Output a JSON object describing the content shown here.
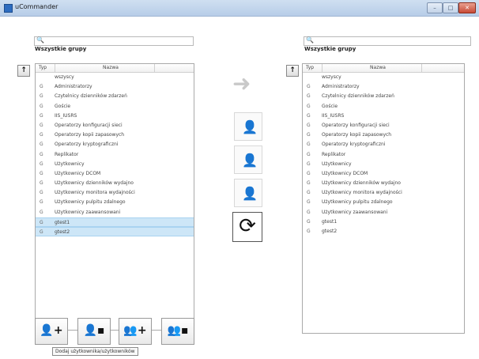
{
  "window": {
    "title": "uCommander",
    "controls": {
      "minimize": "–",
      "maximize": "□",
      "close": "✕"
    }
  },
  "left_panel": {
    "search_placeholder": "",
    "group_title": "Wszystkie grupy",
    "up_button": "↑",
    "columns": {
      "type": "Typ",
      "name": "Nazwa"
    },
    "rows": [
      {
        "type": "",
        "name": "wszyscy"
      },
      {
        "type": "G",
        "name": "Administratorzy"
      },
      {
        "type": "G",
        "name": "Czytelnicy dzienników zdarzeń"
      },
      {
        "type": "G",
        "name": "Goście"
      },
      {
        "type": "G",
        "name": "IIS_IUSRS"
      },
      {
        "type": "G",
        "name": "Operatorzy konfiguracji sieci"
      },
      {
        "type": "G",
        "name": "Operatorzy kopii zapasowych"
      },
      {
        "type": "G",
        "name": "Operatorzy kryptograficzni"
      },
      {
        "type": "G",
        "name": "Replikator"
      },
      {
        "type": "G",
        "name": "Użytkownicy"
      },
      {
        "type": "G",
        "name": "Użytkownicy DCOM"
      },
      {
        "type": "G",
        "name": "Użytkownicy dzienników wydajno"
      },
      {
        "type": "G",
        "name": "Użytkownicy monitora wydajności"
      },
      {
        "type": "G",
        "name": "Użytkownicy pulpitu zdalnego"
      },
      {
        "type": "G",
        "name": "Użytkownicy zaawansowani"
      },
      {
        "type": "G",
        "name": "gtest1",
        "selected": true
      },
      {
        "type": "G",
        "name": "gtest2",
        "selected": true
      }
    ]
  },
  "right_panel": {
    "search_placeholder": "",
    "group_title": "Wszystkie grupy",
    "up_button": "↑",
    "columns": {
      "type": "Typ",
      "name": "Nazwa"
    },
    "rows": [
      {
        "type": "",
        "name": "wszyscy"
      },
      {
        "type": "G",
        "name": "Administratorzy"
      },
      {
        "type": "G",
        "name": "Czytelnicy dzienników zdarzeń"
      },
      {
        "type": "G",
        "name": "Goście"
      },
      {
        "type": "G",
        "name": "IIS_IUSRS"
      },
      {
        "type": "G",
        "name": "Operatorzy konfiguracji sieci"
      },
      {
        "type": "G",
        "name": "Operatorzy kopii zapasowych"
      },
      {
        "type": "G",
        "name": "Operatorzy kryptograficzni"
      },
      {
        "type": "G",
        "name": "Replikator"
      },
      {
        "type": "G",
        "name": "Użytkownicy"
      },
      {
        "type": "G",
        "name": "Użytkownicy DCOM"
      },
      {
        "type": "G",
        "name": "Użytkownicy dzienników wydajno"
      },
      {
        "type": "G",
        "name": "Użytkownicy monitora wydajności"
      },
      {
        "type": "G",
        "name": "Użytkownicy pulpitu zdalnego"
      },
      {
        "type": "G",
        "name": "Użytkownicy zaawansowani"
      },
      {
        "type": "G",
        "name": "gtest1"
      },
      {
        "type": "G",
        "name": "gtest2"
      }
    ]
  },
  "middle": {
    "arrow": "➜",
    "buttons": [
      {
        "icon": "user-add-icon",
        "glyph": "👤"
      },
      {
        "icon": "user-remove-icon",
        "glyph": "👤"
      },
      {
        "icon": "user-move-icon",
        "glyph": "👤"
      }
    ],
    "swap_glyph": "⟳"
  },
  "bottom_buttons": [
    {
      "icon": "add-user-icon",
      "glyph": "👤+"
    },
    {
      "icon": "remove-user-icon",
      "glyph": "👤▪"
    },
    {
      "icon": "add-users-icon",
      "glyph": "👥+"
    },
    {
      "icon": "remove-users-icon",
      "glyph": "👥▪"
    }
  ],
  "tooltip": "Dodaj użytkownika/użytkowników"
}
